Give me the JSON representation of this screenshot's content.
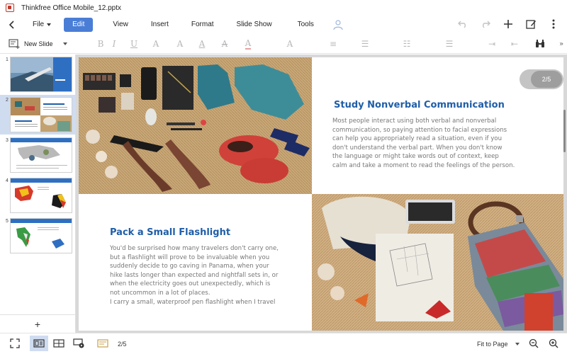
{
  "window": {
    "title": "Thinkfree Office Mobile_12.pptx"
  },
  "menu": {
    "file": "File",
    "edit": "Edit",
    "view": "View",
    "insert": "Insert",
    "format": "Format",
    "slideshow": "Slide Show",
    "tools": "Tools"
  },
  "toolbar": {
    "new_slide": "New Slide"
  },
  "thumbnails": [
    {
      "num": "1"
    },
    {
      "num": "2"
    },
    {
      "num": "3"
    },
    {
      "num": "4"
    },
    {
      "num": "5"
    }
  ],
  "slide": {
    "heading1": "Study Nonverbal Communication",
    "body1": [
      "Most people interact using both verbal and nonverbal",
      "communication, so paying attention to facial expressions",
      "can help you appropriately read a situation, even if you",
      "don't understand the verbal part. When you don't know",
      "the language or might take words out of context, keep",
      "calm and take a moment to read the feelings of the person."
    ],
    "heading2": "Pack a Small Flashlight",
    "body2": [
      "You'd be surprised how many travelers don't carry one,",
      "but a flashlight will prove to be invaluable when you",
      "suddenly decide to go caving in Panama, when your",
      "hike lasts longer than expected and nightfall sets in, or",
      "when the electricity goes out unexpectedly, which is",
      "not uncommon in a lot of places.",
      "I carry a small, waterproof pen flashlight when I travel"
    ],
    "page_indicator": "2/5"
  },
  "status": {
    "add_slide": "+",
    "page": "2/5",
    "zoom": "Fit to Page"
  }
}
